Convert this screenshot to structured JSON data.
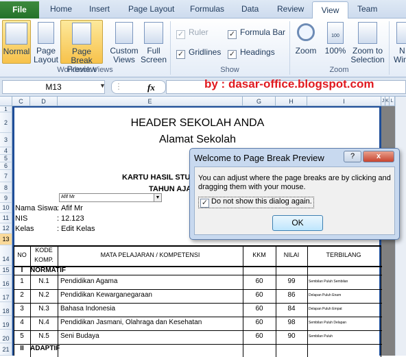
{
  "tabs": [
    "File",
    "Home",
    "Insert",
    "Page Layout",
    "Formulas",
    "Data",
    "Review",
    "View",
    "Team"
  ],
  "ribbon": {
    "workbook_views": {
      "group": "Workbook Views",
      "normal": "Normal",
      "page_layout": [
        "Page",
        "Layout"
      ],
      "page_break": [
        "Page Break",
        "Preview"
      ],
      "custom": [
        "Custom",
        "Views"
      ],
      "full": [
        "Full",
        "Screen"
      ]
    },
    "show": {
      "group": "Show",
      "ruler": "Ruler",
      "formula_bar": "Formula Bar",
      "gridlines": "Gridlines",
      "headings": "Headings"
    },
    "zoom": {
      "group": "Zoom",
      "zoom": "Zoom",
      "pct": "100%",
      "selection": [
        "Zoom to",
        "Selection"
      ],
      "pct_icon": "100"
    },
    "window": {
      "new": [
        "N",
        "Win"
      ]
    }
  },
  "namebox": "M13",
  "fx": "fx",
  "watermark": "by : dasar-office.blogspot.com",
  "columns": [
    "C",
    "D",
    "E",
    "G",
    "H",
    "I",
    "J",
    "K",
    "L"
  ],
  "rows": [
    "1",
    "2",
    "3",
    "4",
    "5",
    "6",
    "7",
    "8",
    "9",
    "10",
    "11",
    "12",
    "13",
    "14",
    "15",
    "16",
    "17",
    "18",
    "19",
    "20",
    "21"
  ],
  "sheet": {
    "header1": "HEADER SEKOLAH ANDA",
    "header2": "Alamat Sekolah",
    "card": "KARTU HASIL STUDI",
    "tahun": "TAHUN AJA",
    "dropdown": "Afif Mr",
    "info": [
      {
        "label": "Nama Siswa",
        "sep": ":",
        "value": "Afif Mr"
      },
      {
        "label": "NIS",
        "sep": ":",
        "value": "12.123"
      },
      {
        "label": "Kelas",
        "sep": ":",
        "value": "Edit Kelas"
      }
    ],
    "table_headers": {
      "no": "NO",
      "kode": [
        "KODE",
        "KOMP."
      ],
      "mapel": "MATA PELAJARAN / KOMPETENSI",
      "kkm": "KKM",
      "nilai": "NILAI",
      "terbilang": "TERBILANG"
    },
    "sec1": {
      "num": "I",
      "label": "NORMATIF"
    },
    "subjects": [
      {
        "no": "1",
        "kode": "N.1",
        "name": "Pendidikan Agama",
        "kkm": "60",
        "nilai": "99",
        "terbilang": "Sembilan Puluh Sembilan"
      },
      {
        "no": "2",
        "kode": "N.2",
        "name": "Pendidikan Kewarganegaraan",
        "kkm": "60",
        "nilai": "86",
        "terbilang": "Delapan Puluh Enam"
      },
      {
        "no": "3",
        "kode": "N.3",
        "name": "Bahasa Indonesia",
        "kkm": "60",
        "nilai": "84",
        "terbilang": "Delapan Puluh Empat"
      },
      {
        "no": "4",
        "kode": "N.4",
        "name": "Pendidikan Jasmani, Olahraga dan Kesehatan",
        "kkm": "60",
        "nilai": "98",
        "terbilang": "Sembilan Puluh Delapan"
      },
      {
        "no": "5",
        "kode": "N.5",
        "name": "Seni Budaya",
        "kkm": "60",
        "nilai": "90",
        "terbilang": "Sembilan Puluh"
      }
    ],
    "sec2": {
      "num": "II",
      "label": "ADAPTIF"
    }
  },
  "dialog": {
    "title": "Welcome to Page Break Preview",
    "help": "?",
    "close": "x",
    "message": "You can adjust where the page breaks are by clicking and dragging them with your mouse.",
    "checkbox": "Do not show this dialog again.",
    "ok": "OK"
  }
}
